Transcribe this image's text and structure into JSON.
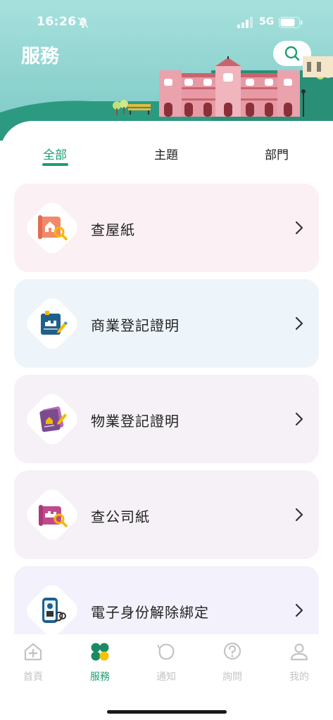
{
  "status_bar": {
    "time": "16:26",
    "network": "5G",
    "icons": [
      "bell-off-icon",
      "signal-icon",
      "battery-icon"
    ]
  },
  "header": {
    "title": "服務",
    "search_icon": "search-icon"
  },
  "tabs": [
    {
      "label": "全部",
      "active": true
    },
    {
      "label": "主題",
      "active": false
    },
    {
      "label": "部門",
      "active": false
    }
  ],
  "services": [
    {
      "label": "查屋紙",
      "icon": "house-document-search-icon",
      "bg": "#fbf1f4"
    },
    {
      "label": "商業登記證明",
      "icon": "business-registration-icon",
      "bg": "#eef5fa"
    },
    {
      "label": "物業登記證明",
      "icon": "property-registration-icon",
      "bg": "#f5f1f6"
    },
    {
      "label": "查公司紙",
      "icon": "company-document-search-icon",
      "bg": "#f5f1f6"
    },
    {
      "label": "電子身份解除綁定",
      "icon": "eid-unbind-icon",
      "bg": "#f3f1fb"
    }
  ],
  "bottom_nav": [
    {
      "label": "首頁",
      "icon": "home-icon",
      "active": false
    },
    {
      "label": "服務",
      "icon": "services-icon",
      "active": true
    },
    {
      "label": "通知",
      "icon": "notification-icon",
      "active": false
    },
    {
      "label": "詢問",
      "icon": "help-icon",
      "active": false
    },
    {
      "label": "我的",
      "icon": "profile-icon",
      "active": false
    }
  ],
  "colors": {
    "accent": "#1b9e73",
    "header_bg": "#9edbd7",
    "inactive_nav": "#c4c4c4"
  }
}
